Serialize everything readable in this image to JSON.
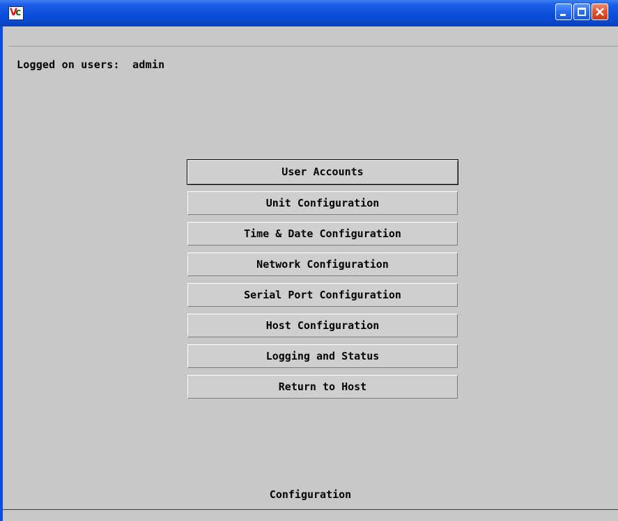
{
  "window": {
    "icon_text_left": "V",
    "icon_text_right": "c",
    "title": ""
  },
  "header": {
    "logged_on_label": "Logged on users:  admin"
  },
  "menu": {
    "items": [
      {
        "label": "User Accounts",
        "focused": true
      },
      {
        "label": "Unit Configuration"
      },
      {
        "label": "Time & Date Configuration"
      },
      {
        "label": "Network Configuration"
      },
      {
        "label": "Serial Port Configuration"
      },
      {
        "label": "Host Configuration"
      },
      {
        "label": "Logging and Status"
      },
      {
        "label": "Return to Host"
      }
    ]
  },
  "footer": {
    "status": "Configuration"
  },
  "colors": {
    "titlebar": "#0a4fdc",
    "client_bg": "#c8c8c8",
    "button_bg": "#cfcfcf",
    "close_button": "#e2552e"
  }
}
